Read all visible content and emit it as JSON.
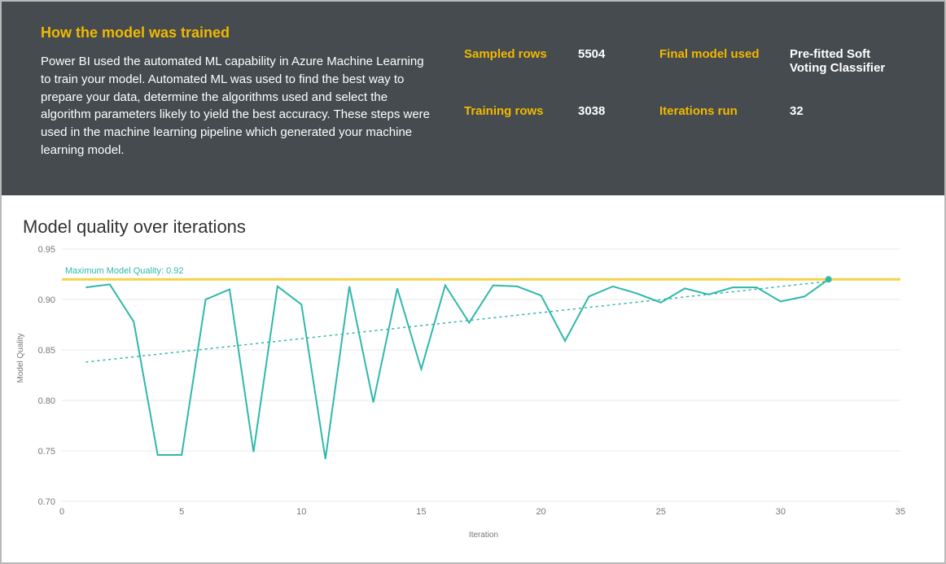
{
  "header": {
    "title": "How the model was trained",
    "description": "Power BI used the automated ML capability in Azure Machine Learning to train your model. Automated ML was used to find the best way to prepare your data, determine the algorithms used and select the algorithm parameters likely to yield the best accuracy. These steps were used in the machine learning pipeline which generated your machine learning model.",
    "stats": {
      "sampled_rows_label": "Sampled rows",
      "sampled_rows_value": "5504",
      "training_rows_label": "Training rows",
      "training_rows_value": "3038",
      "final_model_label": "Final model used",
      "final_model_value": "Pre-fitted Soft Voting Classifier",
      "iterations_label": "Iterations run",
      "iterations_value": "32"
    }
  },
  "chart": {
    "title": "Model quality over iterations",
    "ylabel": "Model Quality",
    "xlabel": "Iteration",
    "max_label": "Maximum Model Quality: 0.92",
    "yticks": [
      "0.70",
      "0.75",
      "0.80",
      "0.85",
      "0.90",
      "0.95"
    ],
    "xticks": [
      "0",
      "5",
      "10",
      "15",
      "20",
      "25",
      "30",
      "35"
    ]
  },
  "chart_data": {
    "type": "line",
    "title": "Model quality over iterations",
    "xlabel": "Iteration",
    "ylabel": "Model Quality",
    "ylim": [
      0.7,
      0.95
    ],
    "xlim": [
      0,
      35
    ],
    "max_line": 0.92,
    "trend_line": {
      "x": [
        1,
        32
      ],
      "y": [
        0.838,
        0.918
      ]
    },
    "x": [
      1,
      2,
      3,
      4,
      5,
      6,
      7,
      8,
      9,
      10,
      11,
      12,
      13,
      14,
      15,
      16,
      17,
      18,
      19,
      20,
      21,
      22,
      23,
      24,
      25,
      26,
      27,
      28,
      29,
      30,
      31,
      32
    ],
    "values": [
      0.912,
      0.915,
      0.878,
      0.746,
      0.746,
      0.9,
      0.91,
      0.749,
      0.913,
      0.895,
      0.742,
      0.913,
      0.798,
      0.911,
      0.831,
      0.914,
      0.877,
      0.914,
      0.913,
      0.904,
      0.859,
      0.903,
      0.913,
      0.906,
      0.897,
      0.911,
      0.905,
      0.912,
      0.912,
      0.898,
      0.903,
      0.92
    ]
  }
}
